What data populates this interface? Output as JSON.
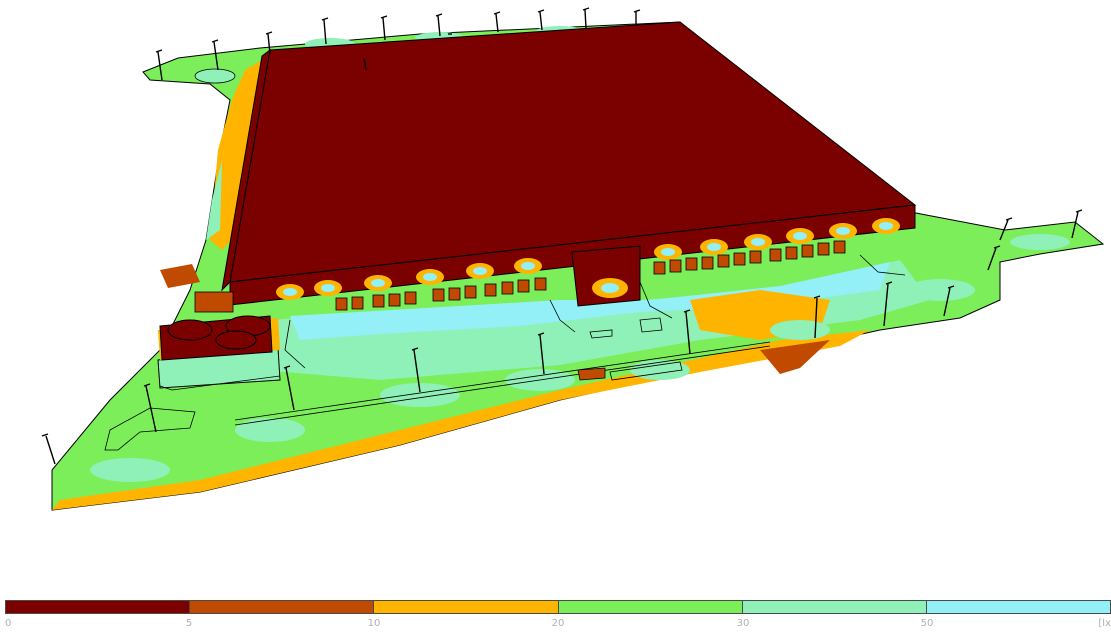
{
  "legend": {
    "colors": [
      "#7b0000",
      "#c04a00",
      "#ffb400",
      "#7cee5a",
      "#8ff0b8",
      "#92f0f6"
    ],
    "ticks": [
      "0",
      "5",
      "10",
      "20",
      "30",
      "50"
    ],
    "unit": "[lx"
  },
  "scene": {
    "colors": {
      "very_low": "#7b0000",
      "low": "#c04a00",
      "mid": "#ffb400",
      "mid_high": "#7cee5a",
      "high": "#8ff0b8",
      "very_high": "#92f0f6",
      "outline": "#000000"
    }
  }
}
